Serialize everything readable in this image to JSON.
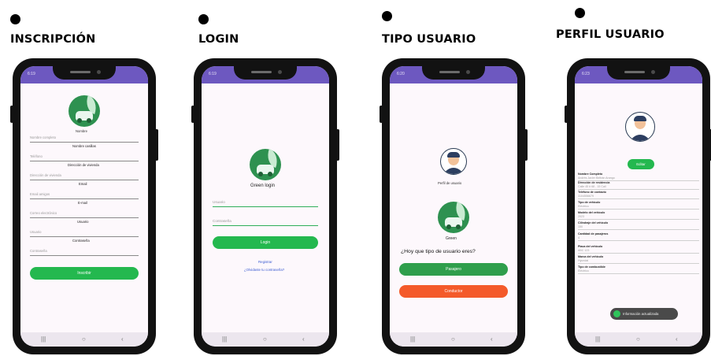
{
  "screens": {
    "inscripcion": {
      "title": "INSCRIPCIÓN",
      "status_time": "6:19",
      "logo_caption": "Nombre",
      "fields": [
        {
          "placeholder": "Nombre completo",
          "value": "Nombre casillas"
        },
        {
          "placeholder": "Teléfono",
          "value": "Dirección de vivienda"
        },
        {
          "placeholder": "Dirección de vivienda",
          "value": "Email"
        },
        {
          "placeholder": "Email amigos",
          "value": "E-mail"
        },
        {
          "placeholder": "Correo electrónico",
          "value": "Usuario"
        },
        {
          "placeholder": "Usuario",
          "value": "Contraseña"
        },
        {
          "placeholder": "Contraseña",
          "value": ""
        }
      ],
      "submit_label": "Inscribir"
    },
    "login": {
      "title": "LOGIN",
      "status_time": "6:19",
      "app_name": "Green login",
      "username_placeholder": "Usuario",
      "password_placeholder": "Contraseña",
      "login_label": "Login",
      "register_link": "Registrar",
      "forgot_link": "¿Olvidaste tu contraseña?"
    },
    "tipo_usuario": {
      "title": "TIPO USUARIO",
      "status_time": "6:20",
      "avatar_caption": "Perfil de usuario",
      "app_name": "Green",
      "question": "¿Hoy que tipo de usuario eres?",
      "option_1": "Pasajero",
      "option_2": "Conductor"
    },
    "perfil_usuario": {
      "title": "PERFIL USUARIO",
      "status_time": "6:23",
      "edit_label": "Editar",
      "rows": [
        {
          "label": "Nombre Completo",
          "value": "Andrés Javier Beltrán Arango"
        },
        {
          "label": "Dirección de residencia",
          "value": "Calle 45 # 68 - 15 Cali"
        },
        {
          "label": "Teléfono de contacto",
          "value": "3104556679"
        },
        {
          "label": "Tipo de vehículo",
          "value": "Eléctrico"
        },
        {
          "label": "Modelo del vehículo",
          "value": "2023"
        },
        {
          "label": "Cilindraje del vehículo",
          "value": "150"
        },
        {
          "label": "Cantidad de pasajeros",
          "value": "4"
        },
        {
          "label": "Placa del vehículo",
          "value": "ABC 123"
        },
        {
          "label": "Marca del vehículo",
          "value": "Hyundai"
        },
        {
          "label": "Tipo de combustible",
          "value": "Eléctrico"
        }
      ],
      "toast": "Información actualizada"
    }
  },
  "nav_icons": [
    "recent-apps-icon",
    "home-icon",
    "back-icon"
  ],
  "nav_glyphs": {
    "recents": "|||",
    "home": "○",
    "back": "‹"
  },
  "colors": {
    "status_bar": "#6d58c0",
    "primary_green": "#24b84f",
    "orange": "#f45a2a",
    "phone_frame": "#121212"
  }
}
